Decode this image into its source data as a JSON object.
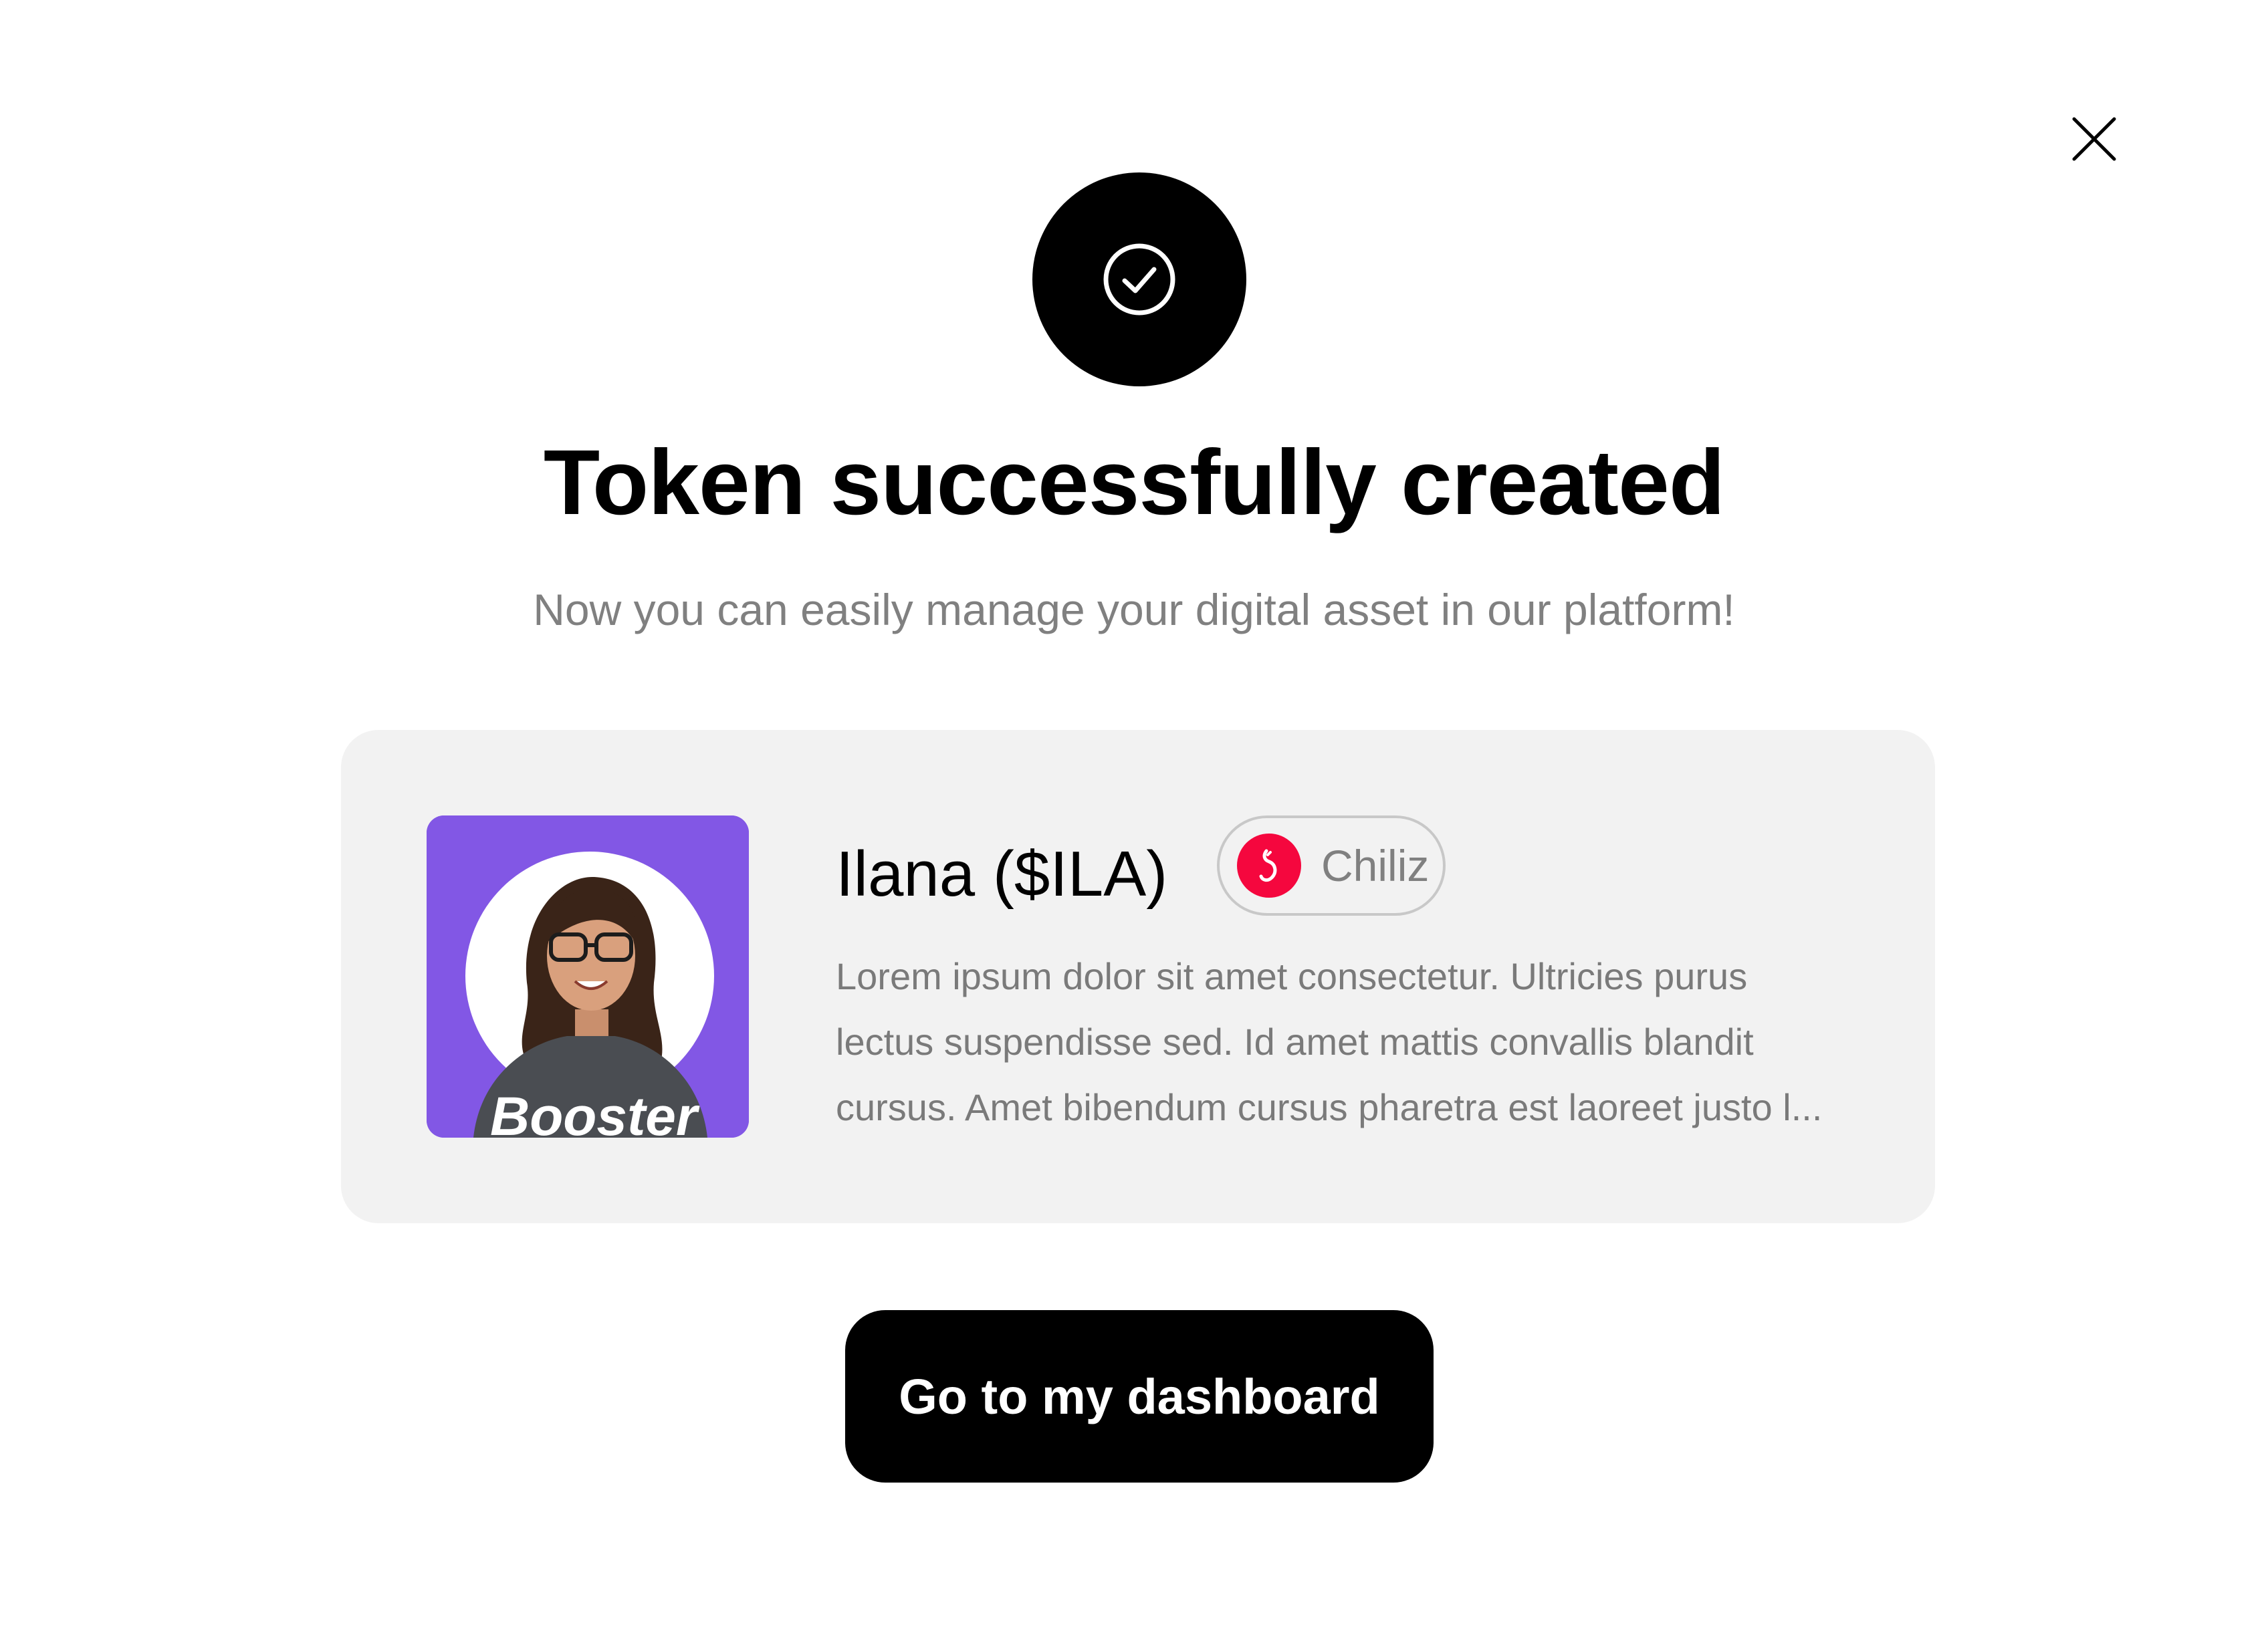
{
  "dialog": {
    "close_icon": "close-icon",
    "status_icon": "check-circle-icon",
    "title": "Token successfully created",
    "subtitle": "Now you can easily manage your digital asset in our platform!"
  },
  "token": {
    "avatar_icon": "user-avatar",
    "name": "Ilana ($ILA)",
    "chain": {
      "icon": "chiliz-logo-icon",
      "label": "Chiliz",
      "color": "#f5073e"
    },
    "description_lines": [
      "Lorem ipsum dolor sit amet consectetur. Ultricies purus",
      "lectus suspendisse sed. Id amet mattis convallis blandit",
      "cursus. Amet bibendum cursus pharetra est laoreet justo l..."
    ]
  },
  "actions": {
    "primary_label": "Go to my dashboard"
  },
  "colors": {
    "avatar_background": "#8257e5",
    "card_background": "#f2f2f2",
    "primary_button": "#000000",
    "muted_text": "#808080"
  }
}
